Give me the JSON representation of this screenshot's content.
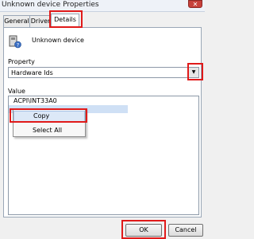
{
  "window": {
    "title": "Unknown device Properties",
    "close_glyph": "✕"
  },
  "tabs": [
    {
      "label": "General"
    },
    {
      "label": "Driver"
    },
    {
      "label": "Details"
    }
  ],
  "device": {
    "name": "Unknown device",
    "icon": "unknown-device-icon"
  },
  "property": {
    "label": "Property",
    "selected": "Hardware Ids",
    "dropdown_glyph": "▼"
  },
  "value": {
    "label": "Value",
    "items": [
      "ACPI\\INT33A0"
    ]
  },
  "context_menu": {
    "items": [
      {
        "label": "Copy"
      },
      {
        "label": "Select All"
      }
    ]
  },
  "buttons": {
    "ok": "OK",
    "cancel": "Cancel"
  },
  "colors": {
    "highlight": "#e01a1a",
    "selection": "#cfe0f5"
  }
}
